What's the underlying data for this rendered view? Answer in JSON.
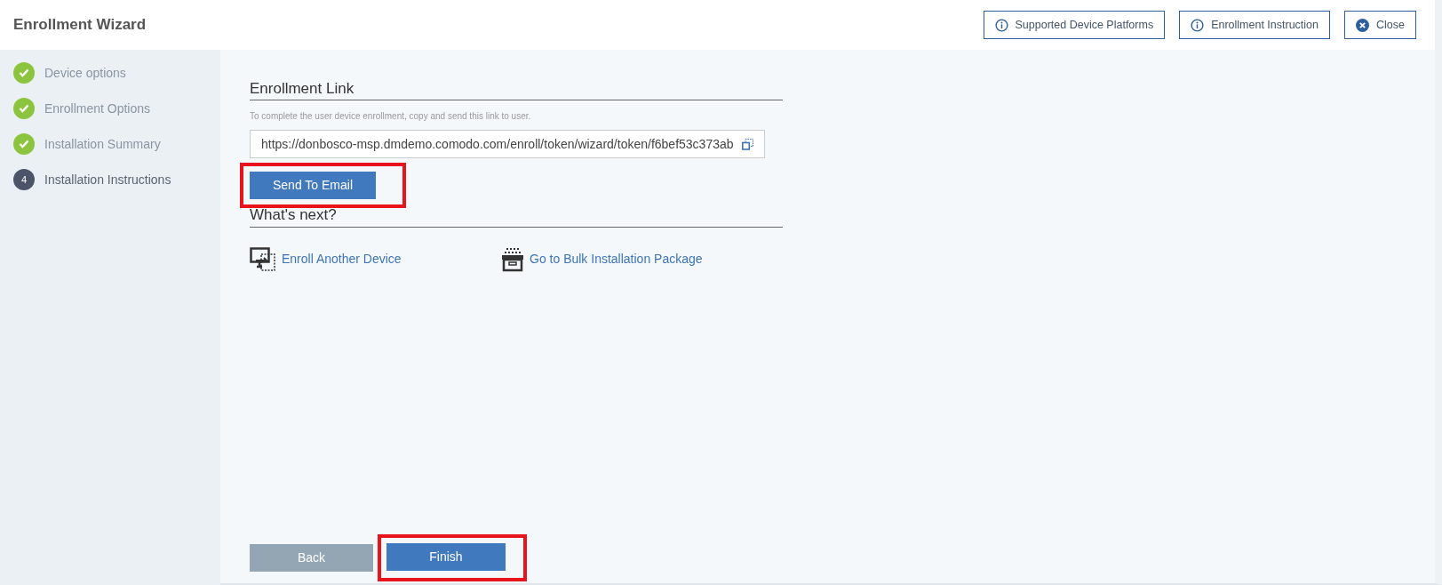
{
  "window": {
    "title": "Enrollment Wizard"
  },
  "header_buttons": [
    {
      "label": "Supported Device Platforms",
      "kind": "info"
    },
    {
      "label": "Enrollment Instruction",
      "kind": "info"
    },
    {
      "label": "Close",
      "kind": "close"
    }
  ],
  "steps": [
    {
      "label": "Device options",
      "done": true,
      "selected": false
    },
    {
      "label": "Enrollment Options",
      "done": true,
      "selected": false
    },
    {
      "label": "Installation Summary",
      "done": true,
      "selected": false
    },
    {
      "label": "Installation Instructions",
      "number": "4",
      "done": false,
      "selected": true
    }
  ],
  "enrollment_link": {
    "heading": "Enrollment Link",
    "hint": "To complete the user device enrollment, copy and send this link to user.",
    "value": "https://donbosco-msp.dmdemo.comodo.com/enroll/token/wizard/token/f6bef53c373ab",
    "send_button": {
      "label": "Send To Email",
      "highlighted": true
    }
  },
  "whats_next": {
    "heading": "What's next?",
    "links": [
      {
        "label": "Enroll Another Device",
        "kind": "device"
      },
      {
        "label": "Go to Bulk Installation Package",
        "kind": "package"
      }
    ]
  },
  "footer_buttons": [
    {
      "label": "Back",
      "kind": "secondary",
      "highlighted": false
    },
    {
      "label": "Finish",
      "kind": "primary",
      "highlighted": true
    }
  ]
}
